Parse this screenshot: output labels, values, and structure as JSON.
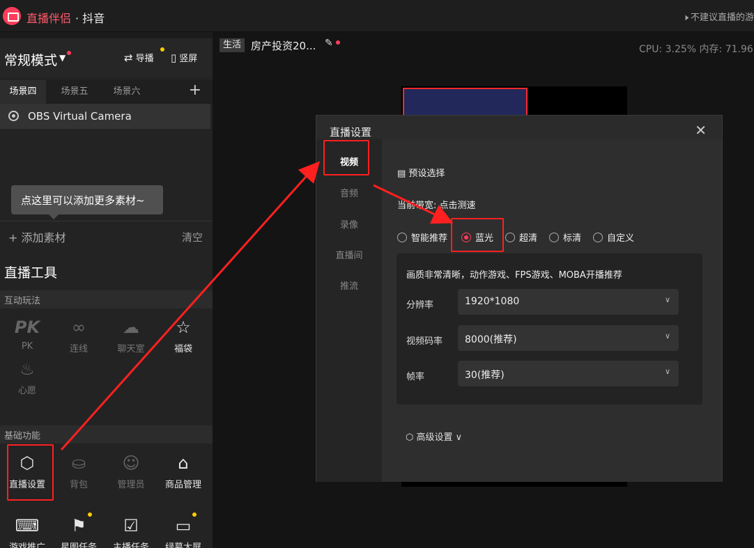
{
  "titlebar": {
    "app_name": "直播伴侣",
    "app_platform": "· 抖音",
    "notice": "不建议直播的游"
  },
  "left_panel": {
    "mode": "常规模式",
    "guide_label": "导播",
    "portrait_label": "竖屏",
    "scene_tabs": [
      "场景四",
      "场景五",
      "场景六"
    ],
    "active_scene": "场景四",
    "source_item": "OBS Virtual Camera",
    "tooltip": "点这里可以添加更多素材~",
    "add_material": "添加素材",
    "clear": "清空",
    "tools_title": "直播工具",
    "section_interactive": "互动玩法",
    "interactive_tools": [
      "PK",
      "连线",
      "聊天室",
      "福袋",
      "心愿"
    ],
    "section_basic": "基础功能",
    "basic_tools": [
      "直播设置",
      "背包",
      "管理员",
      "商品管理",
      "游戏推广",
      "星图任务",
      "主播任务",
      "绿幕大屏"
    ]
  },
  "stage": {
    "live_tag": "生活",
    "room_title": "房产投资20...",
    "stats": "CPU: 3.25%   内存: 71.96"
  },
  "dialog": {
    "title": "直播设置",
    "nav": [
      "视频",
      "音频",
      "录像",
      "直播间",
      "推流"
    ],
    "active_nav": "视频",
    "preset_heading": "预设选择",
    "bandwidth": "当前带宽: 点击测速",
    "quality_options": [
      "智能推荐",
      "蓝光",
      "超清",
      "标清",
      "自定义"
    ],
    "selected_quality": "蓝光",
    "quality_desc": "画质非常清晰，动作游戏、FPS游戏、MOBA开播推荐",
    "fields": [
      {
        "label": "分辨率",
        "value": "1920*1080"
      },
      {
        "label": "视频码率",
        "value": "8000(推荐)"
      },
      {
        "label": "帧率",
        "value": "30(推荐)"
      }
    ],
    "advanced": "高级设置"
  },
  "colors": {
    "accent": "#ff3d5a",
    "highlight": "#ff2020",
    "bg": "#1b1b1b"
  }
}
